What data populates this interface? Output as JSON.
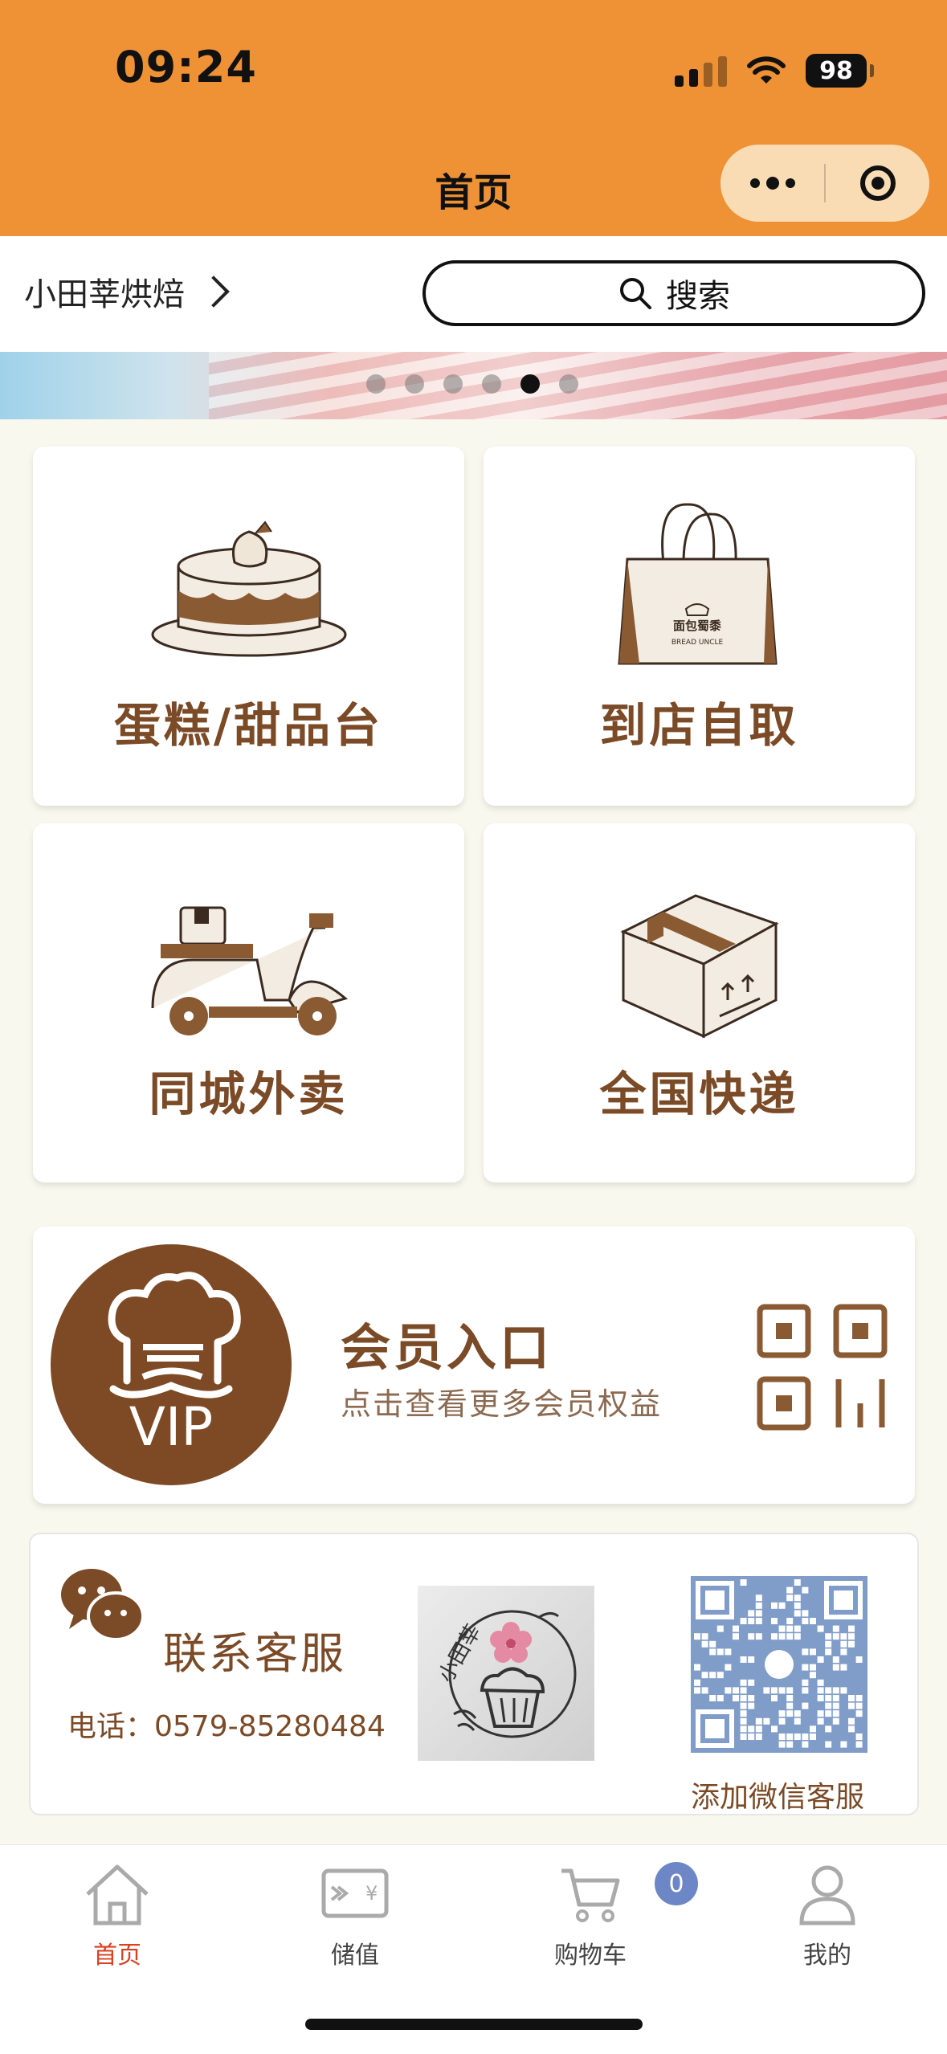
{
  "status": {
    "time": "09:24",
    "battery": "98"
  },
  "nav": {
    "title": "首页"
  },
  "shop": {
    "name": "小田莘烘焙",
    "search_label": "搜索"
  },
  "carousel": {
    "count": 6,
    "active_index": 4
  },
  "tiles": [
    {
      "label": "蛋糕/甜品台",
      "icon": "cake-icon"
    },
    {
      "label": "到店自取",
      "icon": "shopping-bag-icon"
    },
    {
      "label": "同城外卖",
      "icon": "scooter-icon"
    },
    {
      "label": "全国快递",
      "icon": "package-box-icon"
    }
  ],
  "bag_brand": {
    "line1": "面包蜀黍",
    "line2": "BREAD UNCLE"
  },
  "member": {
    "badge": "VIP",
    "title": "会员入口",
    "subtitle": "点击查看更多会员权益"
  },
  "contact": {
    "title": "联系客服",
    "phone": "电话：0579-85280484",
    "logo_text": "小田莘",
    "qr_caption": "添加微信客服"
  },
  "tabbar": {
    "items": [
      {
        "label": "首页",
        "icon": "home-icon",
        "active": true
      },
      {
        "label": "储值",
        "icon": "wallet-card-icon",
        "active": false
      },
      {
        "label": "购物车",
        "icon": "cart-icon",
        "active": false
      },
      {
        "label": "我的",
        "icon": "profile-icon",
        "active": false
      }
    ],
    "cart_count": "0"
  },
  "colors": {
    "header": "#ef9236",
    "brand_brown": "#7b4a26",
    "active_tab": "#d9401f",
    "badge": "#6d86c6"
  }
}
